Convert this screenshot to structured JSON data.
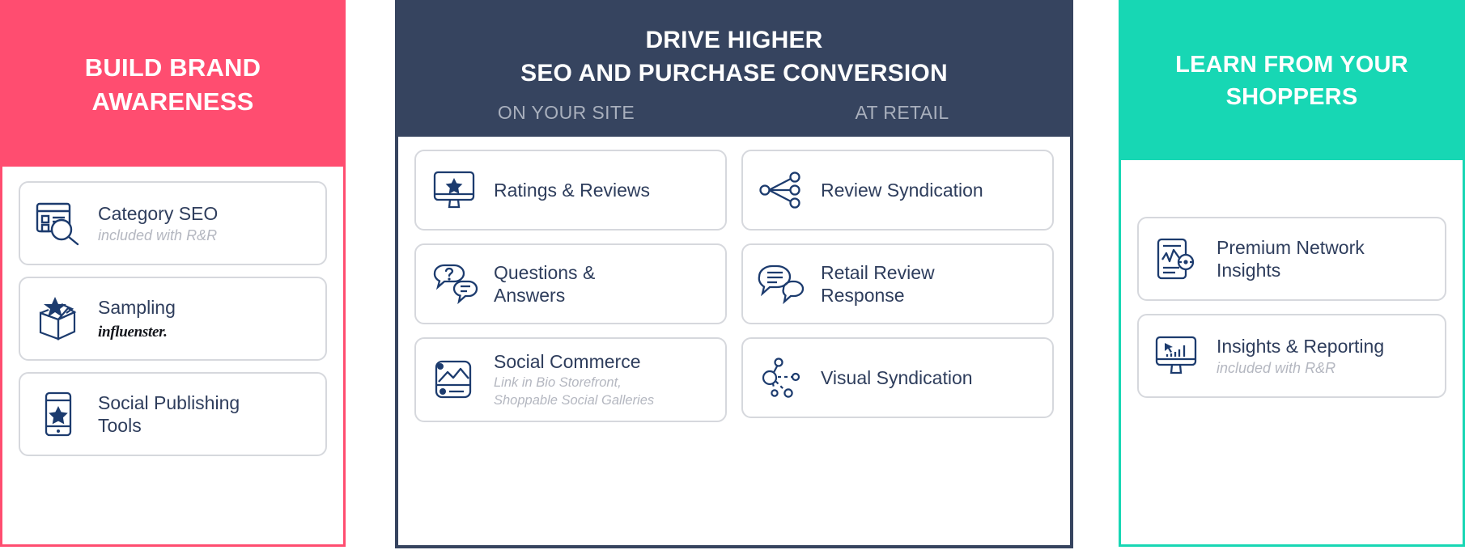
{
  "colors": {
    "pink": "#ff4d70",
    "navy": "#36445f",
    "teal": "#17d7b4",
    "icon_blue": "#1c3b6e",
    "title_text": "#2e3d5c",
    "muted_text": "#b4b7c0",
    "card_border": "#d6d8dd",
    "subheader_text": "#a9b0bd"
  },
  "columns": {
    "left": {
      "header_line1": "BUILD BRAND",
      "header_line2": "AWARENESS",
      "cards": [
        {
          "icon": "category-seo-icon",
          "title": "Category SEO",
          "subtitle": "included with R&R"
        },
        {
          "icon": "sampling-box-icon",
          "title": "Sampling",
          "brand": "influenster."
        },
        {
          "icon": "social-publishing-phone-icon",
          "title_line1": "Social Publishing",
          "title_line2": "Tools"
        }
      ]
    },
    "middle": {
      "header_line1": "DRIVE HIGHER",
      "header_line2": "SEO AND PURCHASE CONVERSION",
      "subheader_left": "ON YOUR SITE",
      "subheader_right": "AT RETAIL",
      "left_cards": [
        {
          "icon": "ratings-reviews-monitor-icon",
          "title": "Ratings & Reviews"
        },
        {
          "icon": "questions-answers-icon",
          "title_line1": "Questions &",
          "title_line2": "Answers"
        },
        {
          "icon": "social-commerce-image-icon",
          "title": "Social Commerce",
          "subtitle_line1": "Link in Bio Storefront,",
          "subtitle_line2": "Shoppable Social Galleries"
        }
      ],
      "right_cards": [
        {
          "icon": "review-syndication-share-icon",
          "title": "Review Syndication"
        },
        {
          "icon": "retail-review-response-chat-icon",
          "title_line1": "Retail Review",
          "title_line2": "Response"
        },
        {
          "icon": "visual-syndication-network-icon",
          "title": "Visual Syndication"
        }
      ]
    },
    "right": {
      "header_line1": "LEARN FROM YOUR",
      "header_line2": "SHOPPERS",
      "cards": [
        {
          "icon": "premium-network-insights-report-icon",
          "title_line1": "Premium Network",
          "title_line2": "Insights"
        },
        {
          "icon": "insights-reporting-monitor-icon",
          "title": "Insights & Reporting",
          "subtitle": "included with R&R"
        }
      ]
    }
  }
}
